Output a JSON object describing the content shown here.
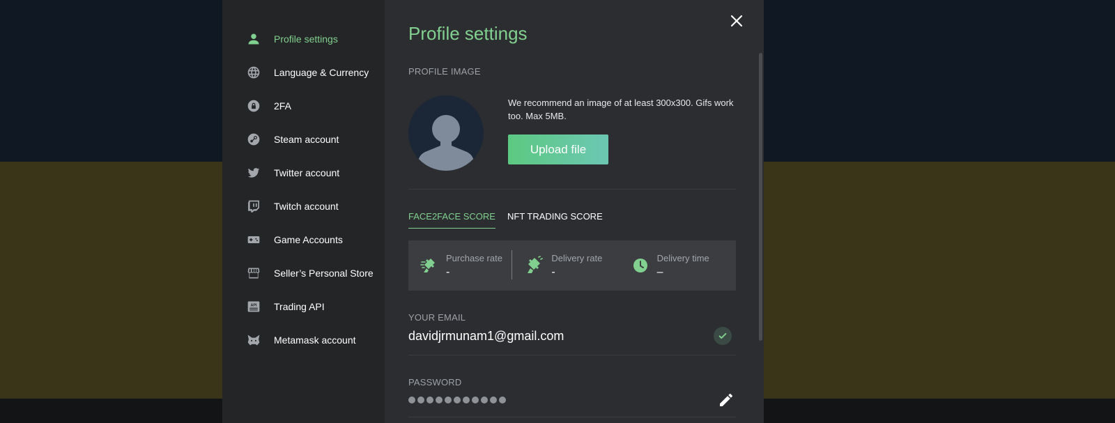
{
  "sidebar": {
    "items": [
      {
        "label": "Profile settings",
        "icon": "person-icon",
        "active": true
      },
      {
        "label": "Language & Currency",
        "icon": "globe-icon"
      },
      {
        "label": "2FA",
        "icon": "lock-icon"
      },
      {
        "label": "Steam account",
        "icon": "steam-icon"
      },
      {
        "label": "Twitter account",
        "icon": "twitter-icon"
      },
      {
        "label": "Twitch account",
        "icon": "twitch-icon"
      },
      {
        "label": "Game Accounts",
        "icon": "gamepad-icon"
      },
      {
        "label": "Seller’s Personal Store",
        "icon": "store-icon"
      },
      {
        "label": "Trading API",
        "icon": "api-icon"
      },
      {
        "label": "Metamask account",
        "icon": "metamask-icon"
      }
    ]
  },
  "main": {
    "title": "Profile settings",
    "profile_image_label": "PROFILE IMAGE",
    "hint": "We recommend an image of at least 300x300. Gifs work too. Max 5MB.",
    "upload_label": "Upload file",
    "tabs": [
      {
        "label": "FACE2FACE SCORE",
        "active": true
      },
      {
        "label": "NFT TRADING SCORE",
        "active": false
      }
    ],
    "scores": [
      {
        "title": "Purchase rate",
        "value": "-",
        "icon": "purchase-rate-icon"
      },
      {
        "title": "Delivery rate",
        "value": "-",
        "icon": "delivery-rate-icon"
      },
      {
        "title": "Delivery time",
        "value": "–",
        "icon": "clock-icon"
      }
    ],
    "email_label": "YOUR EMAIL",
    "email_value": "davidjrmunam1@gmail.com",
    "password_label": "PASSWORD"
  },
  "colors": {
    "accent": "#82d08f",
    "sidebar_bg": "#232527",
    "panel_bg": "#2b2d30",
    "score_bg": "#3b3d41"
  }
}
